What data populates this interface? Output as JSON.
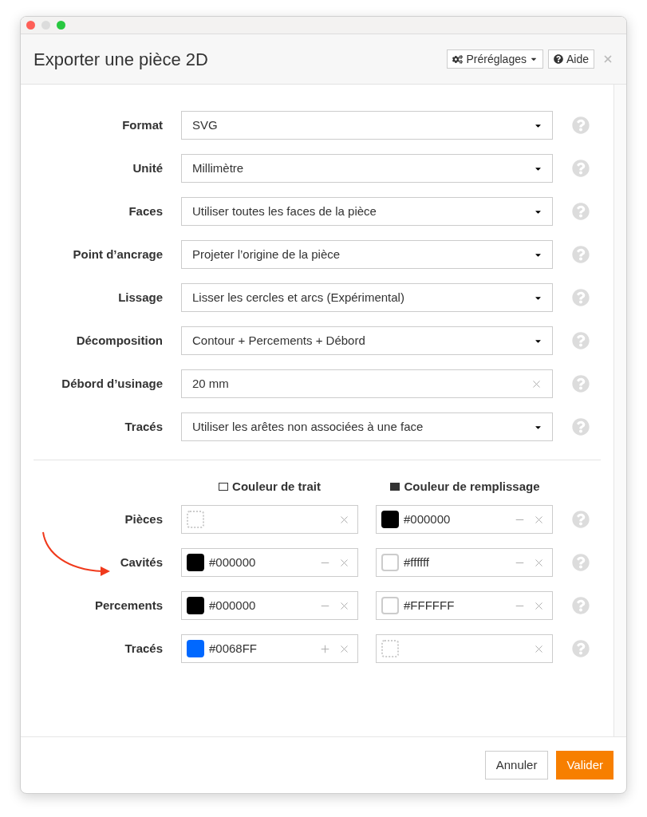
{
  "dialog": {
    "title": "Exporter une pièce 2D",
    "presets_button": "Préréglages",
    "help_button": "Aide"
  },
  "fields": [
    {
      "label": "Format",
      "value": "SVG",
      "kind": "select"
    },
    {
      "label": "Unité",
      "value": "Millimètre",
      "kind": "select"
    },
    {
      "label": "Faces",
      "value": "Utiliser toutes les faces de la pièce",
      "kind": "select"
    },
    {
      "label": "Point d’ancrage",
      "value": "Projeter l’origine de la pièce",
      "kind": "select"
    },
    {
      "label": "Lissage",
      "value": "Lisser les cercles et arcs (Expérimental)",
      "kind": "select"
    },
    {
      "label": "Décomposition",
      "value": "Contour + Percements + Débord",
      "kind": "select"
    },
    {
      "label": "Débord d’usinage",
      "value": "20 mm",
      "kind": "text"
    },
    {
      "label": "Tracés",
      "value": "Utiliser les arêtes non associées à une face",
      "kind": "select"
    }
  ],
  "colors": {
    "stroke_header": "Couleur de trait",
    "fill_header": "Couleur de remplissage",
    "rows": [
      {
        "label": "Pièces",
        "stroke": {
          "kind": "empty"
        },
        "fill": {
          "color": "#000000",
          "value": "#000000",
          "kind": "removable"
        }
      },
      {
        "label": "Cavités",
        "stroke": {
          "color": "#000000",
          "value": "#000000",
          "kind": "removable"
        },
        "fill": {
          "color": "#ffffff",
          "value": "#ffffff",
          "kind": "removable"
        }
      },
      {
        "label": "Percements",
        "stroke": {
          "color": "#000000",
          "value": "#000000",
          "kind": "removable"
        },
        "fill": {
          "color": "#ffffff",
          "value": "#FFFFFF",
          "kind": "removable"
        }
      },
      {
        "label": "Tracés",
        "stroke": {
          "color": "#0068ff",
          "value": "#0068FF",
          "kind": "addable"
        },
        "fill": {
          "kind": "empty"
        }
      }
    ]
  },
  "footer": {
    "cancel": "Annuler",
    "confirm": "Valider"
  }
}
